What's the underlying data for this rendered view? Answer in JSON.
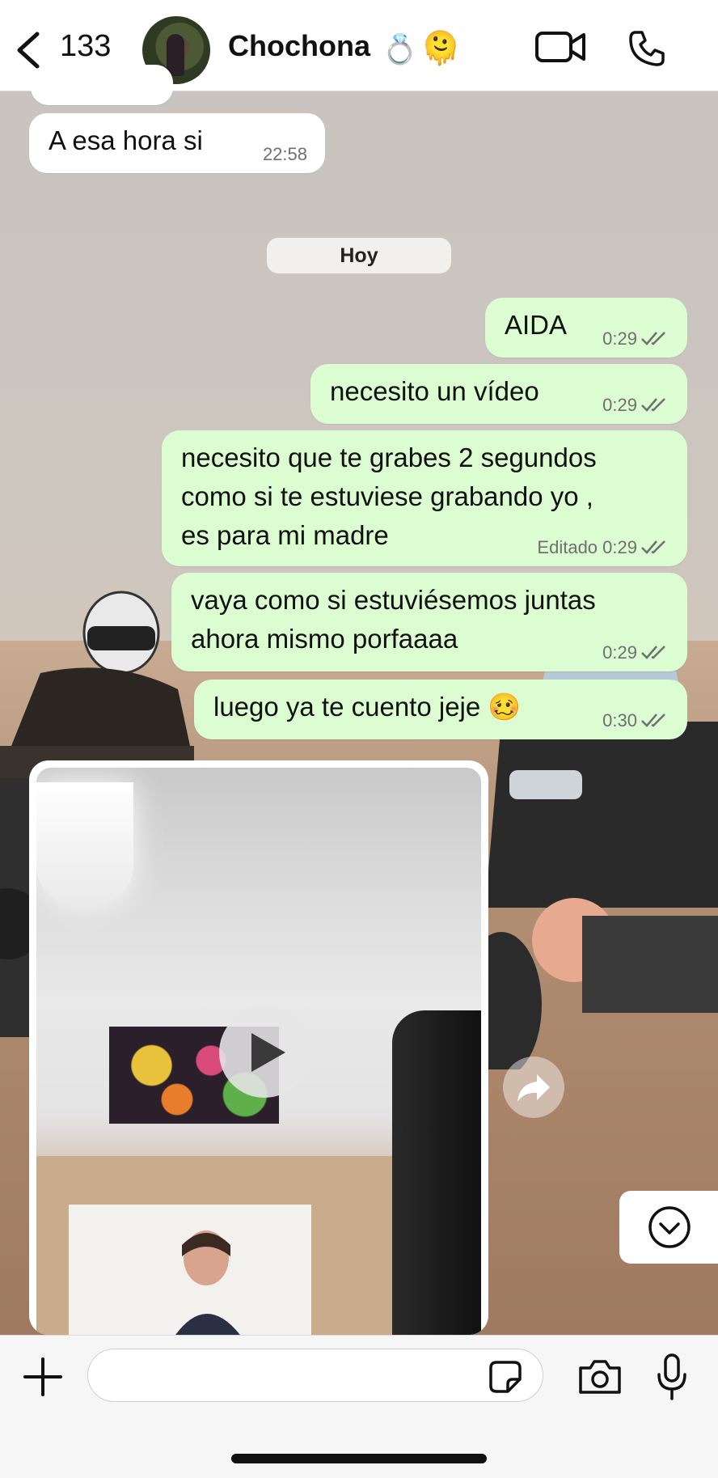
{
  "header": {
    "back_count": "133",
    "contact_name": "Chochona",
    "name_emojis": [
      "💍",
      "🫠"
    ]
  },
  "date_separator": "Hoy",
  "messages": [
    {
      "direction": "incoming",
      "text": "A esa hora si",
      "time": "22:58"
    },
    {
      "direction": "outgoing",
      "text": "AIDA",
      "time": "0:29"
    },
    {
      "direction": "outgoing",
      "text": "necesito un vídeo",
      "time": "0:29"
    },
    {
      "direction": "outgoing",
      "lines": [
        "necesito que te grabes 2 segundos",
        "como si te estuviese grabando yo ,",
        "es para mi madre"
      ],
      "edited_label": "Editado",
      "time": "0:29"
    },
    {
      "direction": "outgoing",
      "lines": [
        "vaya como si estuviésemos juntas",
        "ahora mismo porfaaaa"
      ],
      "time": "0:29"
    },
    {
      "direction": "outgoing",
      "text": "luego ya te cuento jeje",
      "emoji": "🥴",
      "time": "0:30"
    }
  ],
  "input": {
    "placeholder": ""
  },
  "icons": {
    "back": "chevron-left-icon",
    "video_call": "video-camera-icon",
    "call": "phone-icon",
    "play": "play-icon",
    "forward": "forward-icon",
    "scroll_down": "chevron-down-circle-icon",
    "plus": "plus-icon",
    "sticker": "sticker-icon",
    "camera": "camera-icon",
    "mic": "microphone-icon"
  },
  "colors": {
    "outgoing_bubble": "#dcfdd2",
    "incoming_bubble": "#ffffff",
    "read_ticks": "#6f6f6f"
  }
}
